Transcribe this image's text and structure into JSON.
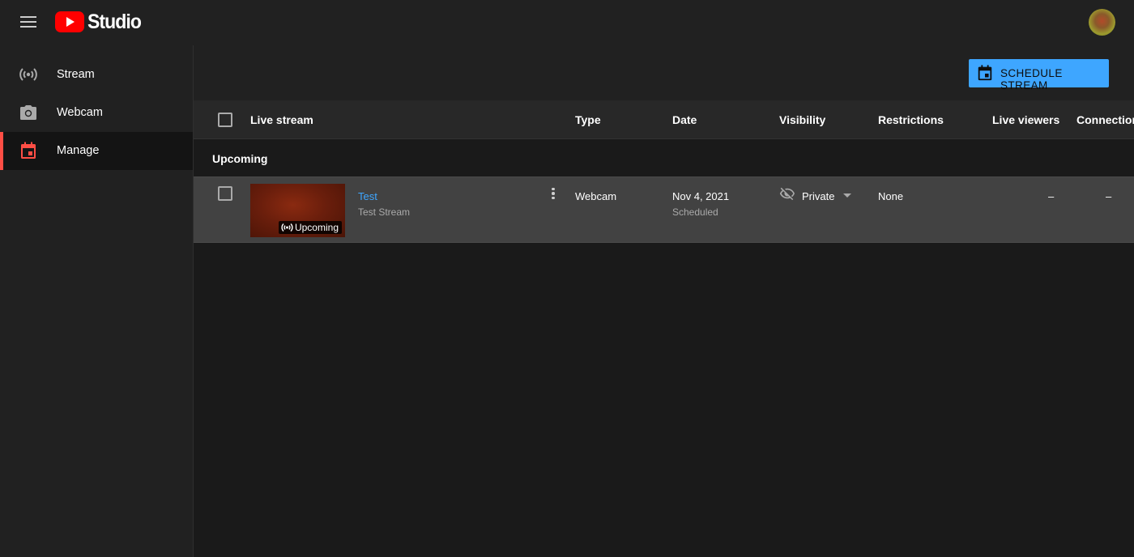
{
  "header": {
    "logo_text": "Studio",
    "menu_icon": "hamburger-menu-icon",
    "logo_icon": "youtube-play-icon",
    "avatar_alt": "account-avatar"
  },
  "sidebar": {
    "items": [
      {
        "label": "Stream",
        "icon": "broadcast-icon",
        "active": false
      },
      {
        "label": "Webcam",
        "icon": "camera-icon",
        "active": false
      },
      {
        "label": "Manage",
        "icon": "calendar-icon",
        "active": true
      }
    ]
  },
  "toolbar": {
    "schedule_label": "SCHEDULE STREAM",
    "schedule_icon": "calendar-icon"
  },
  "table": {
    "columns": {
      "live_stream": "Live stream",
      "type": "Type",
      "date": "Date",
      "visibility": "Visibility",
      "restrictions": "Restrictions",
      "live_viewers": "Live viewers",
      "connection": "Connection"
    },
    "section_label": "Upcoming",
    "rows": [
      {
        "title": "Test",
        "description": "Test Stream",
        "badge": "Upcoming",
        "type": "Webcam",
        "date": "Nov 4, 2021",
        "date_status": "Scheduled",
        "visibility": "Private",
        "restrictions": "None",
        "live_viewers": "–",
        "connection": "–"
      }
    ]
  },
  "colors": {
    "accent_blue": "#3ea6ff",
    "active_red": "#ff4e45",
    "youtube_red": "#ff0000"
  }
}
